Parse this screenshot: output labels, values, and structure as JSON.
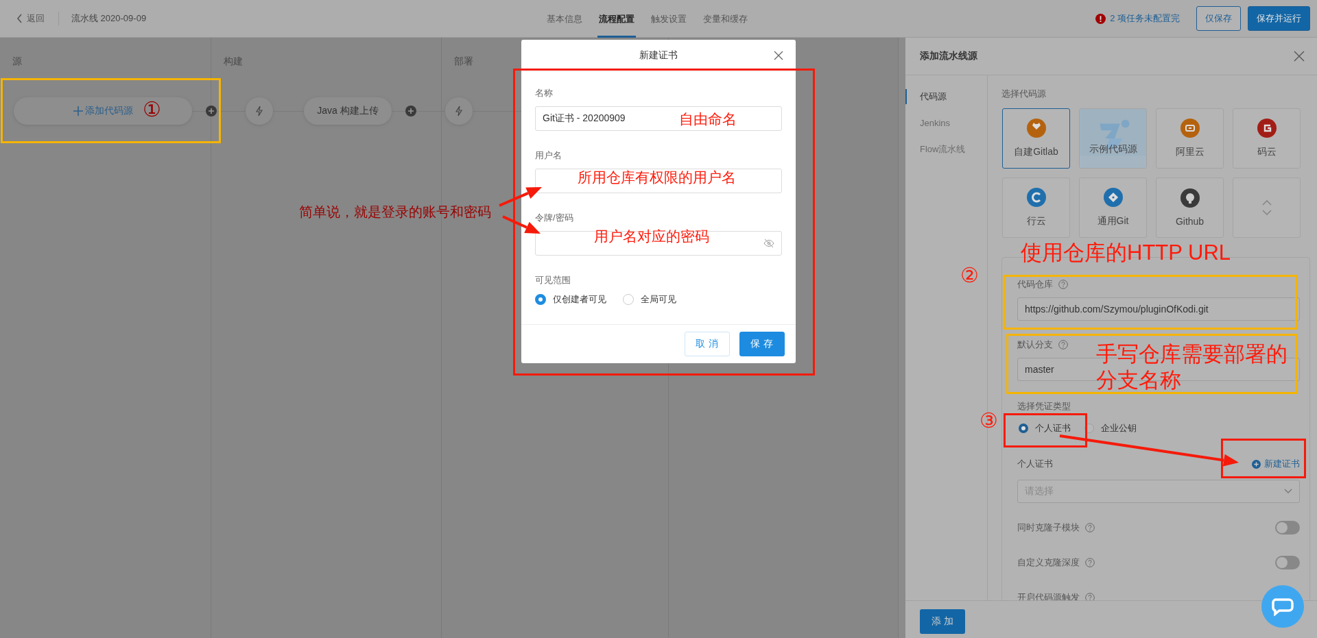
{
  "top_bar": {
    "back": "返回",
    "pipeline_name": "流水线 2020-09-09",
    "tabs": [
      {
        "label": "基本信息",
        "selected": false
      },
      {
        "label": "流程配置",
        "selected": true
      },
      {
        "label": "触发设置",
        "selected": false
      },
      {
        "label": "变量和缓存",
        "selected": false
      }
    ],
    "warning": "2 项任务未配置完",
    "buttons": [
      {
        "label": "仅保存",
        "kind": "secondary"
      },
      {
        "label": "保存并运行",
        "kind": "primary"
      }
    ]
  },
  "canvas": {
    "stages": [
      {
        "title": "源"
      },
      {
        "title": "构建"
      },
      {
        "title": "部署"
      }
    ],
    "nodes": [
      {
        "kind": "add",
        "label": "添加代码源"
      },
      {
        "kind": "plus"
      },
      {
        "kind": "trigger"
      },
      {
        "kind": "job",
        "label": "Java 构建上传"
      },
      {
        "kind": "plus"
      },
      {
        "kind": "trigger"
      }
    ]
  },
  "dialog": {
    "title": "新建证书",
    "fields": [
      {
        "label": "名称",
        "value": "Git证书 - 20200909",
        "kind": "text"
      },
      {
        "label": "用户名",
        "kind": "text"
      },
      {
        "label": "令牌/密码",
        "kind": "password"
      }
    ],
    "visibility": {
      "label": "可见范围",
      "options": [
        {
          "label": "仅创建者可见",
          "selected": true
        },
        {
          "label": "全局可见",
          "selected": false
        }
      ]
    },
    "buttons": [
      {
        "label": "取 消",
        "kind": "secondary"
      },
      {
        "label": "保 存",
        "kind": "primary"
      }
    ]
  },
  "side_panel": {
    "title": "添加流水线源",
    "nav": [
      {
        "label": "代码源",
        "selected": true
      },
      {
        "label": "Jenkins",
        "selected": false
      },
      {
        "label": "Flow流水线",
        "selected": false
      }
    ],
    "source_heading": "选择代码源",
    "sources": [
      {
        "kind": "gitlab",
        "label": "自建Gitlab",
        "selected": true,
        "color": "#b5620f"
      },
      {
        "kind": "sample",
        "label": "示例代码源",
        "selected": false
      },
      {
        "kind": "aliyun",
        "label": "阿里云",
        "selected": false,
        "color": "#b5620f"
      },
      {
        "kind": "gitee",
        "label": "码云",
        "selected": false,
        "color": "#a31d17"
      },
      {
        "kind": "codeup",
        "label": "行云",
        "selected": false,
        "color": "#1f6fad"
      },
      {
        "kind": "git",
        "label": "通用Git",
        "selected": false,
        "color": "#1f6fad"
      },
      {
        "kind": "github",
        "label": "Github",
        "selected": false,
        "color": "#3a3a3a"
      },
      {
        "kind": "expand",
        "selected": false
      }
    ],
    "repo": {
      "label": "代码仓库",
      "value": "https://github.com/Szymou/pluginOfKodi.git"
    },
    "branch": {
      "label": "默认分支",
      "value": "master"
    },
    "credential_type": {
      "label": "选择凭证类型",
      "options": [
        {
          "label": "个人证书",
          "selected": true
        },
        {
          "label": "企业公钥",
          "selected": false
        }
      ]
    },
    "credential": {
      "label": "个人证书",
      "link": "新建证书",
      "placeholder": "请选择"
    },
    "switches": [
      {
        "label": "同时克隆子模块",
        "on": false
      },
      {
        "label": "自定义克隆深度",
        "on": false
      },
      {
        "label": "开启代码源触发"
      }
    ],
    "add_button": "添 加"
  },
  "annotations": {
    "step_one": "①",
    "left_note": "简单说，就是登录的账号和密码",
    "name_note": "自由命名",
    "user_note": "所用仓库有权限的用户名",
    "password_note": "用户名对应的密码",
    "url_note": "使用仓库的HTTP URL",
    "step_two": "②",
    "branch_note": [
      "手写仓库需要部署的",
      "分支名称"
    ],
    "step_three": "③"
  }
}
